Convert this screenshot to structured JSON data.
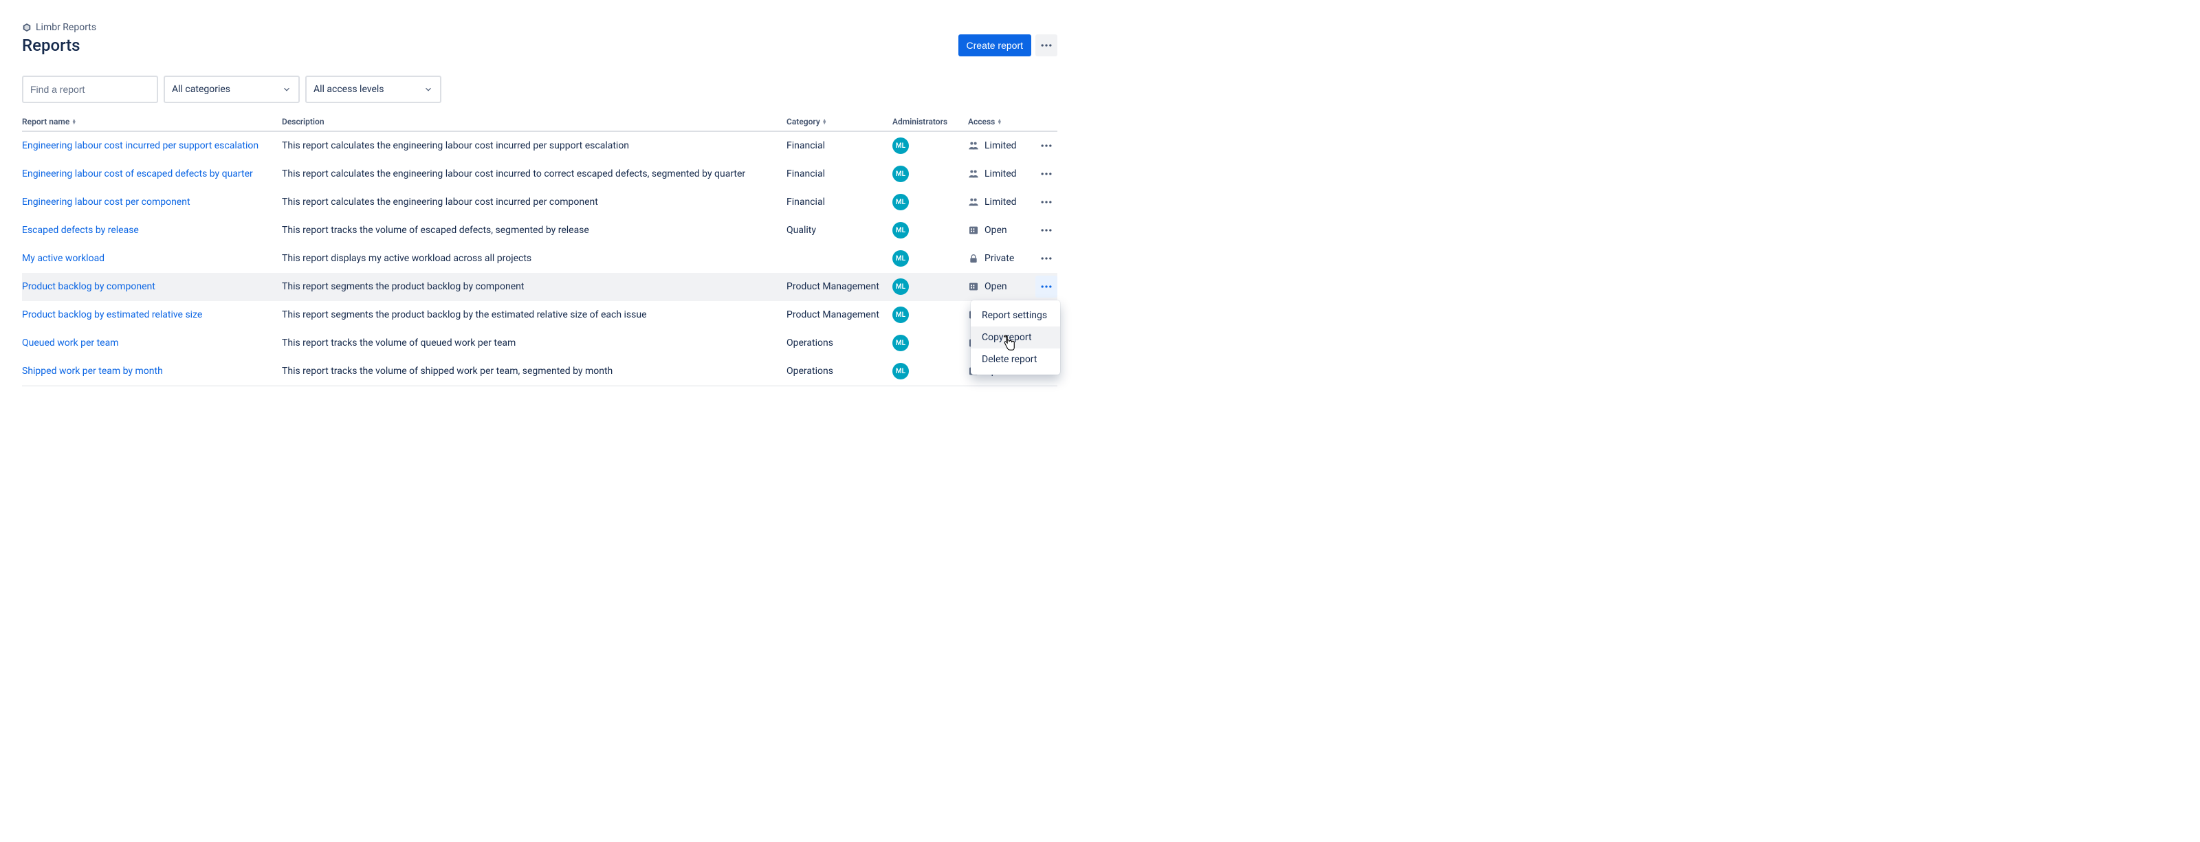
{
  "breadcrumb": {
    "app": "Limbr Reports"
  },
  "page": {
    "title": "Reports"
  },
  "header": {
    "create_label": "Create report"
  },
  "filters": {
    "search_placeholder": "Find a report",
    "category_label": "All categories",
    "access_label": "All access levels"
  },
  "columns": {
    "name": "Report name",
    "description": "Description",
    "category": "Category",
    "administrators": "Administrators",
    "access": "Access"
  },
  "admin_initials": "ML",
  "access_labels": {
    "limited": "Limited",
    "open": "Open",
    "private": "Private"
  },
  "rows": [
    {
      "name": "Engineering labour cost incurred per support escalation",
      "description": "This report calculates the engineering labour cost incurred per support escalation",
      "category": "Financial",
      "access": "limited"
    },
    {
      "name": "Engineering labour cost of escaped defects by quarter",
      "description": "This report calculates the engineering labour cost incurred to correct escaped defects, segmented by quarter",
      "category": "Financial",
      "access": "limited"
    },
    {
      "name": "Engineering labour cost per component",
      "description": "This report calculates the engineering labour cost incurred per component",
      "category": "Financial",
      "access": "limited"
    },
    {
      "name": "Escaped defects by release",
      "description": "This report tracks the volume of escaped defects, segmented by release",
      "category": "Quality",
      "access": "open"
    },
    {
      "name": "My active workload",
      "description": "This report displays my active workload across all projects",
      "category": "",
      "access": "private"
    },
    {
      "name": "Product backlog by component",
      "description": "This report segments the product backlog by component",
      "category": "Product Management",
      "access": "open"
    },
    {
      "name": "Product backlog by estimated relative size",
      "description": "This report segments the product backlog by the estimated relative size of each issue",
      "category": "Product Management",
      "access": "open"
    },
    {
      "name": "Queued work per team",
      "description": "This report tracks the volume of queued work per team",
      "category": "Operations",
      "access": "open"
    },
    {
      "name": "Shipped work per team by month",
      "description": "This report tracks the volume of shipped work per team, segmented by month",
      "category": "Operations",
      "access": "open"
    }
  ],
  "hovered_row_index": 5,
  "dropdown": {
    "open_on_row": 5,
    "items": [
      {
        "label": "Report settings"
      },
      {
        "label": "Copy report"
      },
      {
        "label": "Delete report"
      }
    ],
    "hovered_item_index": 1
  }
}
